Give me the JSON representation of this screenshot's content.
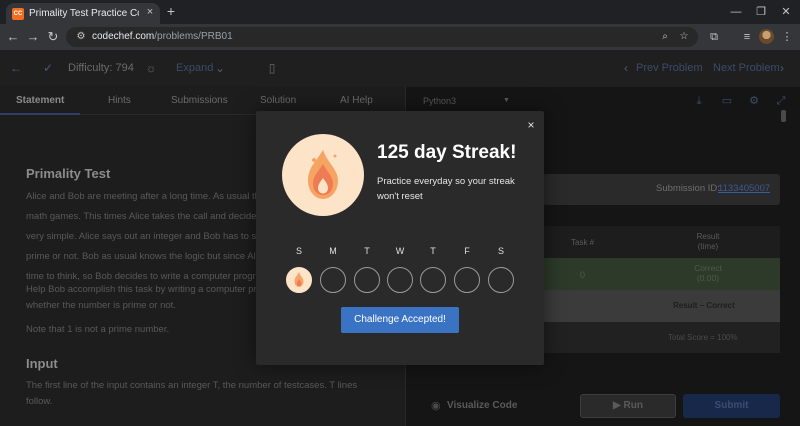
{
  "browser": {
    "tab_favicon_text": "CC",
    "tab_title": "Primality Test Practice Coding P",
    "tab_close": "×",
    "new_tab": "+",
    "window_controls": {
      "minimize": "—",
      "restore": "❐",
      "close": "✕"
    },
    "back_icon": "arrow-left-icon",
    "url_host": "codechef.com",
    "url_path": "/problems/PRB01"
  },
  "header": {
    "difficulty_label": "Difficulty: 794",
    "expand_label": "Expand",
    "prev_problem": "Prev Problem",
    "next_problem": "Next Problem"
  },
  "left_tabs": [
    "Statement",
    "Hints",
    "Submissions",
    "Solution",
    "AI Help"
  ],
  "problem": {
    "title": "Primality Test",
    "lines": [
      "Alice and Bob are meeting after a long time. As usual th",
      "math games. This times Alice takes the call and decides",
      "very simple. Alice says out an integer and Bob has to sa",
      "prime or not. Bob as usual knows the logic but since Ali",
      "time to think, so Bob decides to write a computer progr"
    ],
    "help_lines": [
      "Help Bob accomplish this task by writing a computer pr",
      "whether the number is prime or not."
    ],
    "note": "Note that 1 is not a prime number.",
    "input_heading": "Input",
    "input_lines": [
      "The first line of the input contains an integer T, the number of testcases. T lines",
      "follow."
    ]
  },
  "editor": {
    "language": "Python3"
  },
  "submission": {
    "id_label": "Submission ID:",
    "id_value": "1133405007"
  },
  "results": {
    "col_task": "Task #",
    "col_result_line1": "Result",
    "col_result_line2": "(time)",
    "row_task": "0",
    "row_result_line1": "Correct",
    "row_result_line2": "(0.00)",
    "summary": "Result – Correct",
    "total_score": "Total Score = 100%"
  },
  "actions": {
    "visualize": "Visualize Code",
    "run": "▶ Run",
    "submit": "Submit"
  },
  "modal": {
    "close": "×",
    "title": "125 day Streak!",
    "message": "Practice everyday so your streak won't reset",
    "days": [
      "S",
      "M",
      "T",
      "W",
      "T",
      "F",
      "S"
    ],
    "completed_day_index": 0,
    "button": "Challenge Accepted!"
  },
  "colors": {
    "accent": "#3a73c4",
    "flame": "#f2843e",
    "badge_bg": "#fde3c8"
  }
}
